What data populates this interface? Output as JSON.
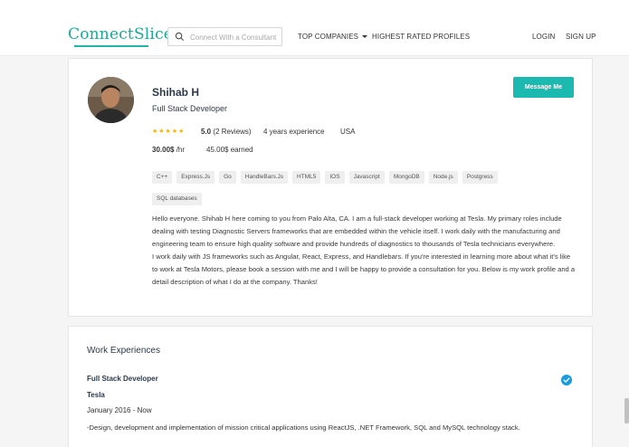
{
  "header": {
    "logo": "ConnectSlice",
    "search_placeholder": "Connect With a Consultant",
    "nav_top_companies": "TOP COMPANIES",
    "nav_highest_rated": "HIGHEST RATED PROFILES",
    "nav_login": "LOGIN",
    "nav_signup": "SIGN UP"
  },
  "profile": {
    "name": "Shihab H",
    "title": "Full Stack Developer",
    "message_button": "Message Me",
    "rating_value": "5.0",
    "reviews": "(2 Reviews)",
    "stars": "★★★★★",
    "experience": "4 years experience",
    "location": "USA",
    "rate": "30.00$",
    "rate_unit": " /hr",
    "earned": "45.00$ earned",
    "tags": [
      "C++",
      "Express.Js",
      "Go",
      "HandleBars.Js",
      "HTML5",
      "IOS",
      "Javascript",
      "MongoDB",
      "Node.js",
      "Postgress",
      "SQL databases"
    ],
    "bio_p1": "Hello everyone. Shihab H here coming to you from Palo Alta, CA. I am a  full-stack developer working at Tesla. My primary roles include dealing with testing Diagnostic Servers frameworks that are embedded within the vehicle itself. I work daily with the manufacturing and engineering team to ensure high quality software and provide hundreds of diagnostics to thousands of Tesla technicians everywhere.",
    "bio_p2": "I work daily with JS frameworks such as Angular, React, Express, and Handlebars. If you're interested in learning more about what it's like to work at Tesla Motors, please book a session with me and I will be happy to provide a consultation for you. Below is my work profile and a detail description of what I do at the company. Thanks!"
  },
  "work": {
    "heading": "Work Experiences",
    "job_title": "Full Stack Developer",
    "company": "Tesla",
    "dates": "January 2016 - Now",
    "description": "-Design, development and implementation of mission critical applications using ReactJS, .NET Framework, SQL and MySQL technology stack."
  },
  "colors": {
    "accent": "#1cb9b0",
    "logo": "#1aa79a",
    "star": "#f5b301",
    "verified": "#1a9be0"
  },
  "icons": {
    "search": "search-icon",
    "caret": "chevron-down-icon",
    "verified": "verified-check-icon"
  }
}
